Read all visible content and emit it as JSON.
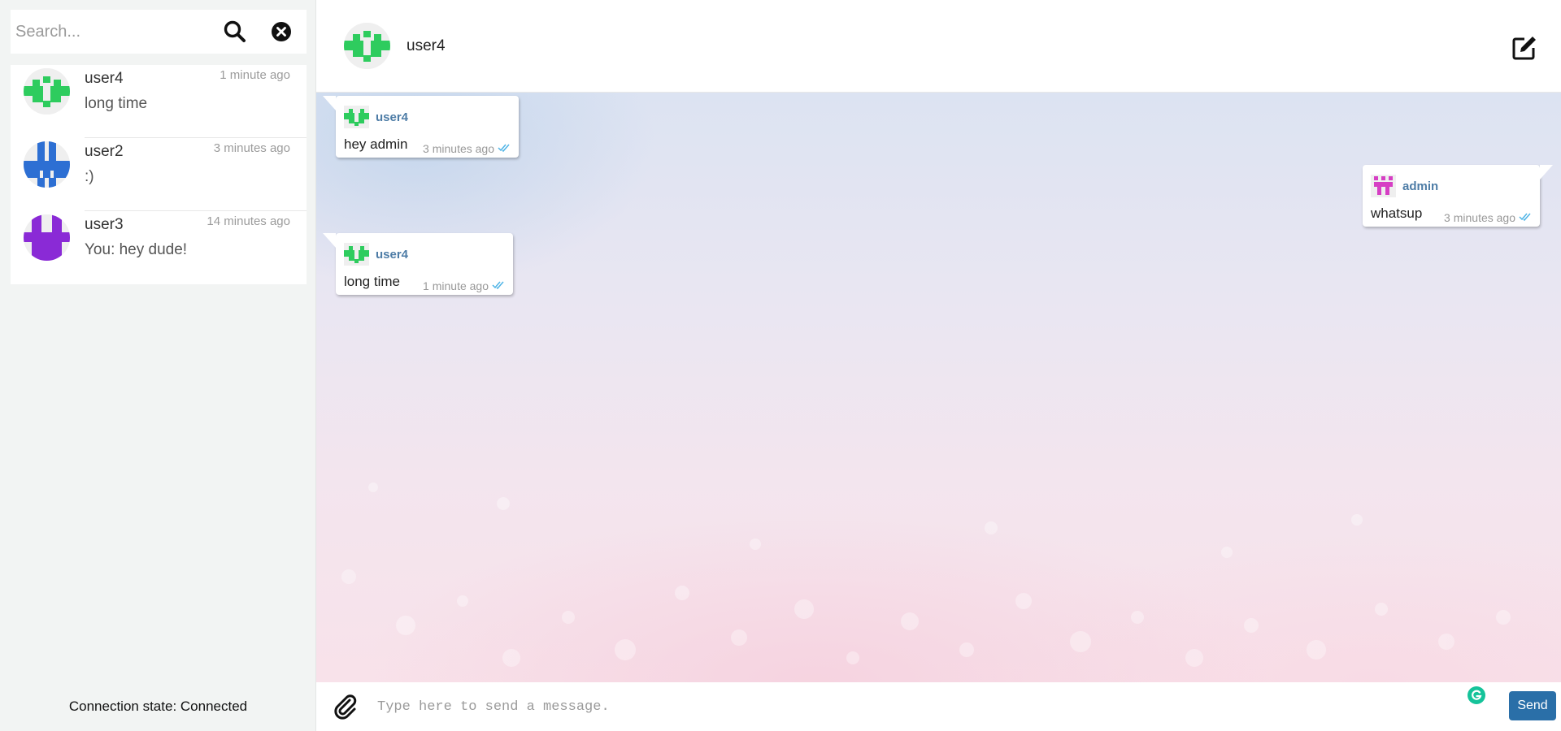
{
  "sidebar": {
    "search": {
      "placeholder": "Search...",
      "value": ""
    },
    "search_icon": "search-icon",
    "clear_icon": "close-circle-icon",
    "conversations": [
      {
        "name": "user4",
        "time": "1 minute ago",
        "preview": "long time",
        "avatar_color": "#2ecc5e",
        "active": true
      },
      {
        "name": "user2",
        "time": "3 minutes ago",
        "preview": ":)",
        "avatar_color": "#2d6fd3"
      },
      {
        "name": "user3",
        "time": "14 minutes ago",
        "preview": "You: hey dude!",
        "avatar_color": "#8a2ad6"
      }
    ],
    "connection_state": "Connection state: Connected"
  },
  "header": {
    "name": "user4",
    "avatar_color": "#2ecc5e",
    "compose_icon": "edit-icon"
  },
  "messages": [
    {
      "sender": "user4",
      "text": "hey admin",
      "time": "3 minutes ago",
      "side": "left",
      "avatar_color": "#2ecc5e",
      "read": true
    },
    {
      "sender": "admin",
      "text": "whatsup",
      "time": "3 minutes ago",
      "side": "right",
      "avatar_color": "#d63fc4",
      "read": true
    },
    {
      "sender": "user4",
      "text": "long time",
      "time": "1 minute ago",
      "side": "left",
      "avatar_color": "#2ecc5e",
      "read": true
    }
  ],
  "composer": {
    "placeholder": "Type here to send a message.",
    "value": "",
    "send_label": "Send",
    "attach_icon": "paperclip-icon",
    "grammarly_icon": "grammarly-icon"
  },
  "colors": {
    "accent": "#2a6fa8",
    "sender_name": "#4d7ca6",
    "read_ticks": "#4fb4e6"
  }
}
